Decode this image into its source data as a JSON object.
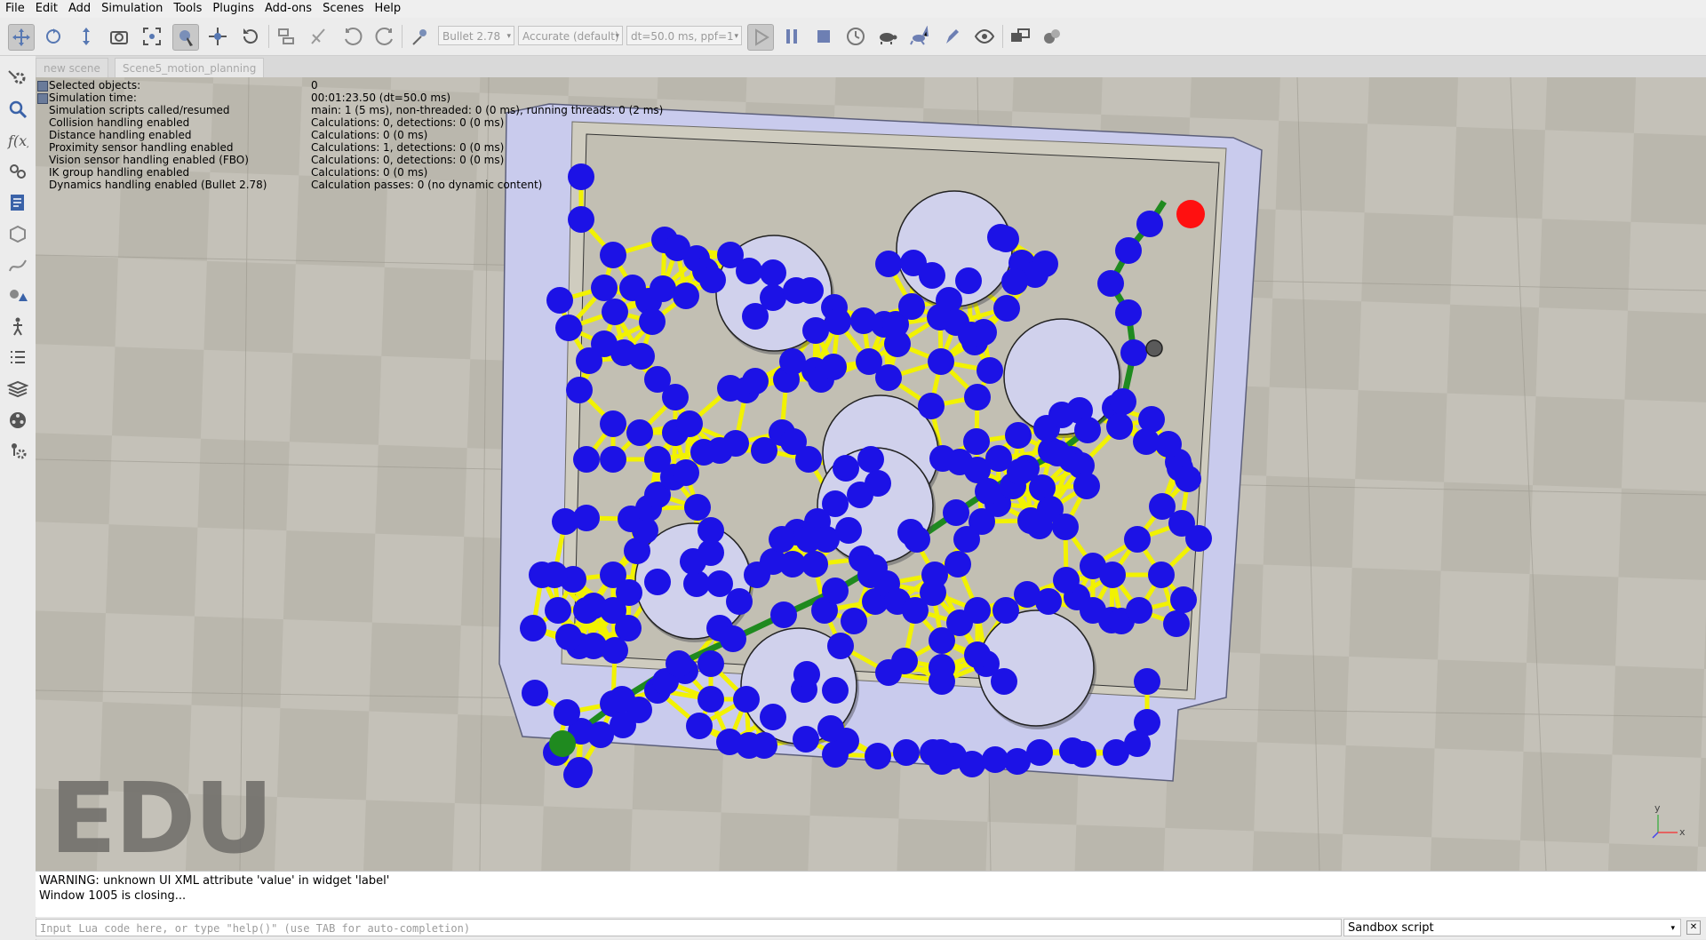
{
  "menu": [
    "File",
    "Edit",
    "Add",
    "Simulation",
    "Tools",
    "Plugins",
    "Add-ons",
    "Scenes",
    "Help"
  ],
  "toolbar": {
    "engine_combo": "Bullet 2.78",
    "accuracy_combo": "Accurate (default)",
    "timestep_combo": "dt=50.0 ms, ppf=1"
  },
  "tabs": [
    "new scene",
    "Scene5_motion_planning"
  ],
  "info": {
    "rows": [
      {
        "label": "Selected objects:",
        "value": "0"
      },
      {
        "label": "Simulation time:",
        "value": "00:01:23.50 (dt=50.0 ms)"
      },
      {
        "label": "Simulation scripts called/resumed",
        "value": "main: 1 (5 ms), non-threaded: 0 (0 ms), running threads: 0 (2 ms)"
      },
      {
        "label": "Collision handling enabled",
        "value": "Calculations: 0, detections: 0 (0 ms)"
      },
      {
        "label": "Distance handling enabled",
        "value": "Calculations: 0 (0 ms)"
      },
      {
        "label": "Proximity sensor handling enabled",
        "value": "Calculations: 1, detections: 0 (0 ms)"
      },
      {
        "label": "Vision sensor handling enabled (FBO)",
        "value": "Calculations: 0, detections: 0 (0 ms)"
      },
      {
        "label": "IK group handling enabled",
        "value": "Calculations: 0 (0 ms)"
      },
      {
        "label": "Dynamics handling enabled (Bullet 2.78)",
        "value": "Calculation passes: 0 (no dynamic content)"
      }
    ]
  },
  "watermark": "EDU",
  "console": {
    "lines": [
      "WARNING: unknown UI XML attribute 'value' in widget 'label'",
      "Window 1005 is closing..."
    ],
    "input_placeholder": "Input Lua code here, or type \"help()\" (use TAB for auto-completion)",
    "script_selector": "Sandbox script"
  },
  "colors": {
    "node": "#1c12e6",
    "edge": "#f2f200",
    "path": "#1f8a1f",
    "start": "#1f8a1f",
    "goal": "#ff1010",
    "obstacle": "#d0d1ec",
    "wall": "#c9cbed"
  },
  "axis_labels": {
    "y": "y",
    "x": "x"
  }
}
